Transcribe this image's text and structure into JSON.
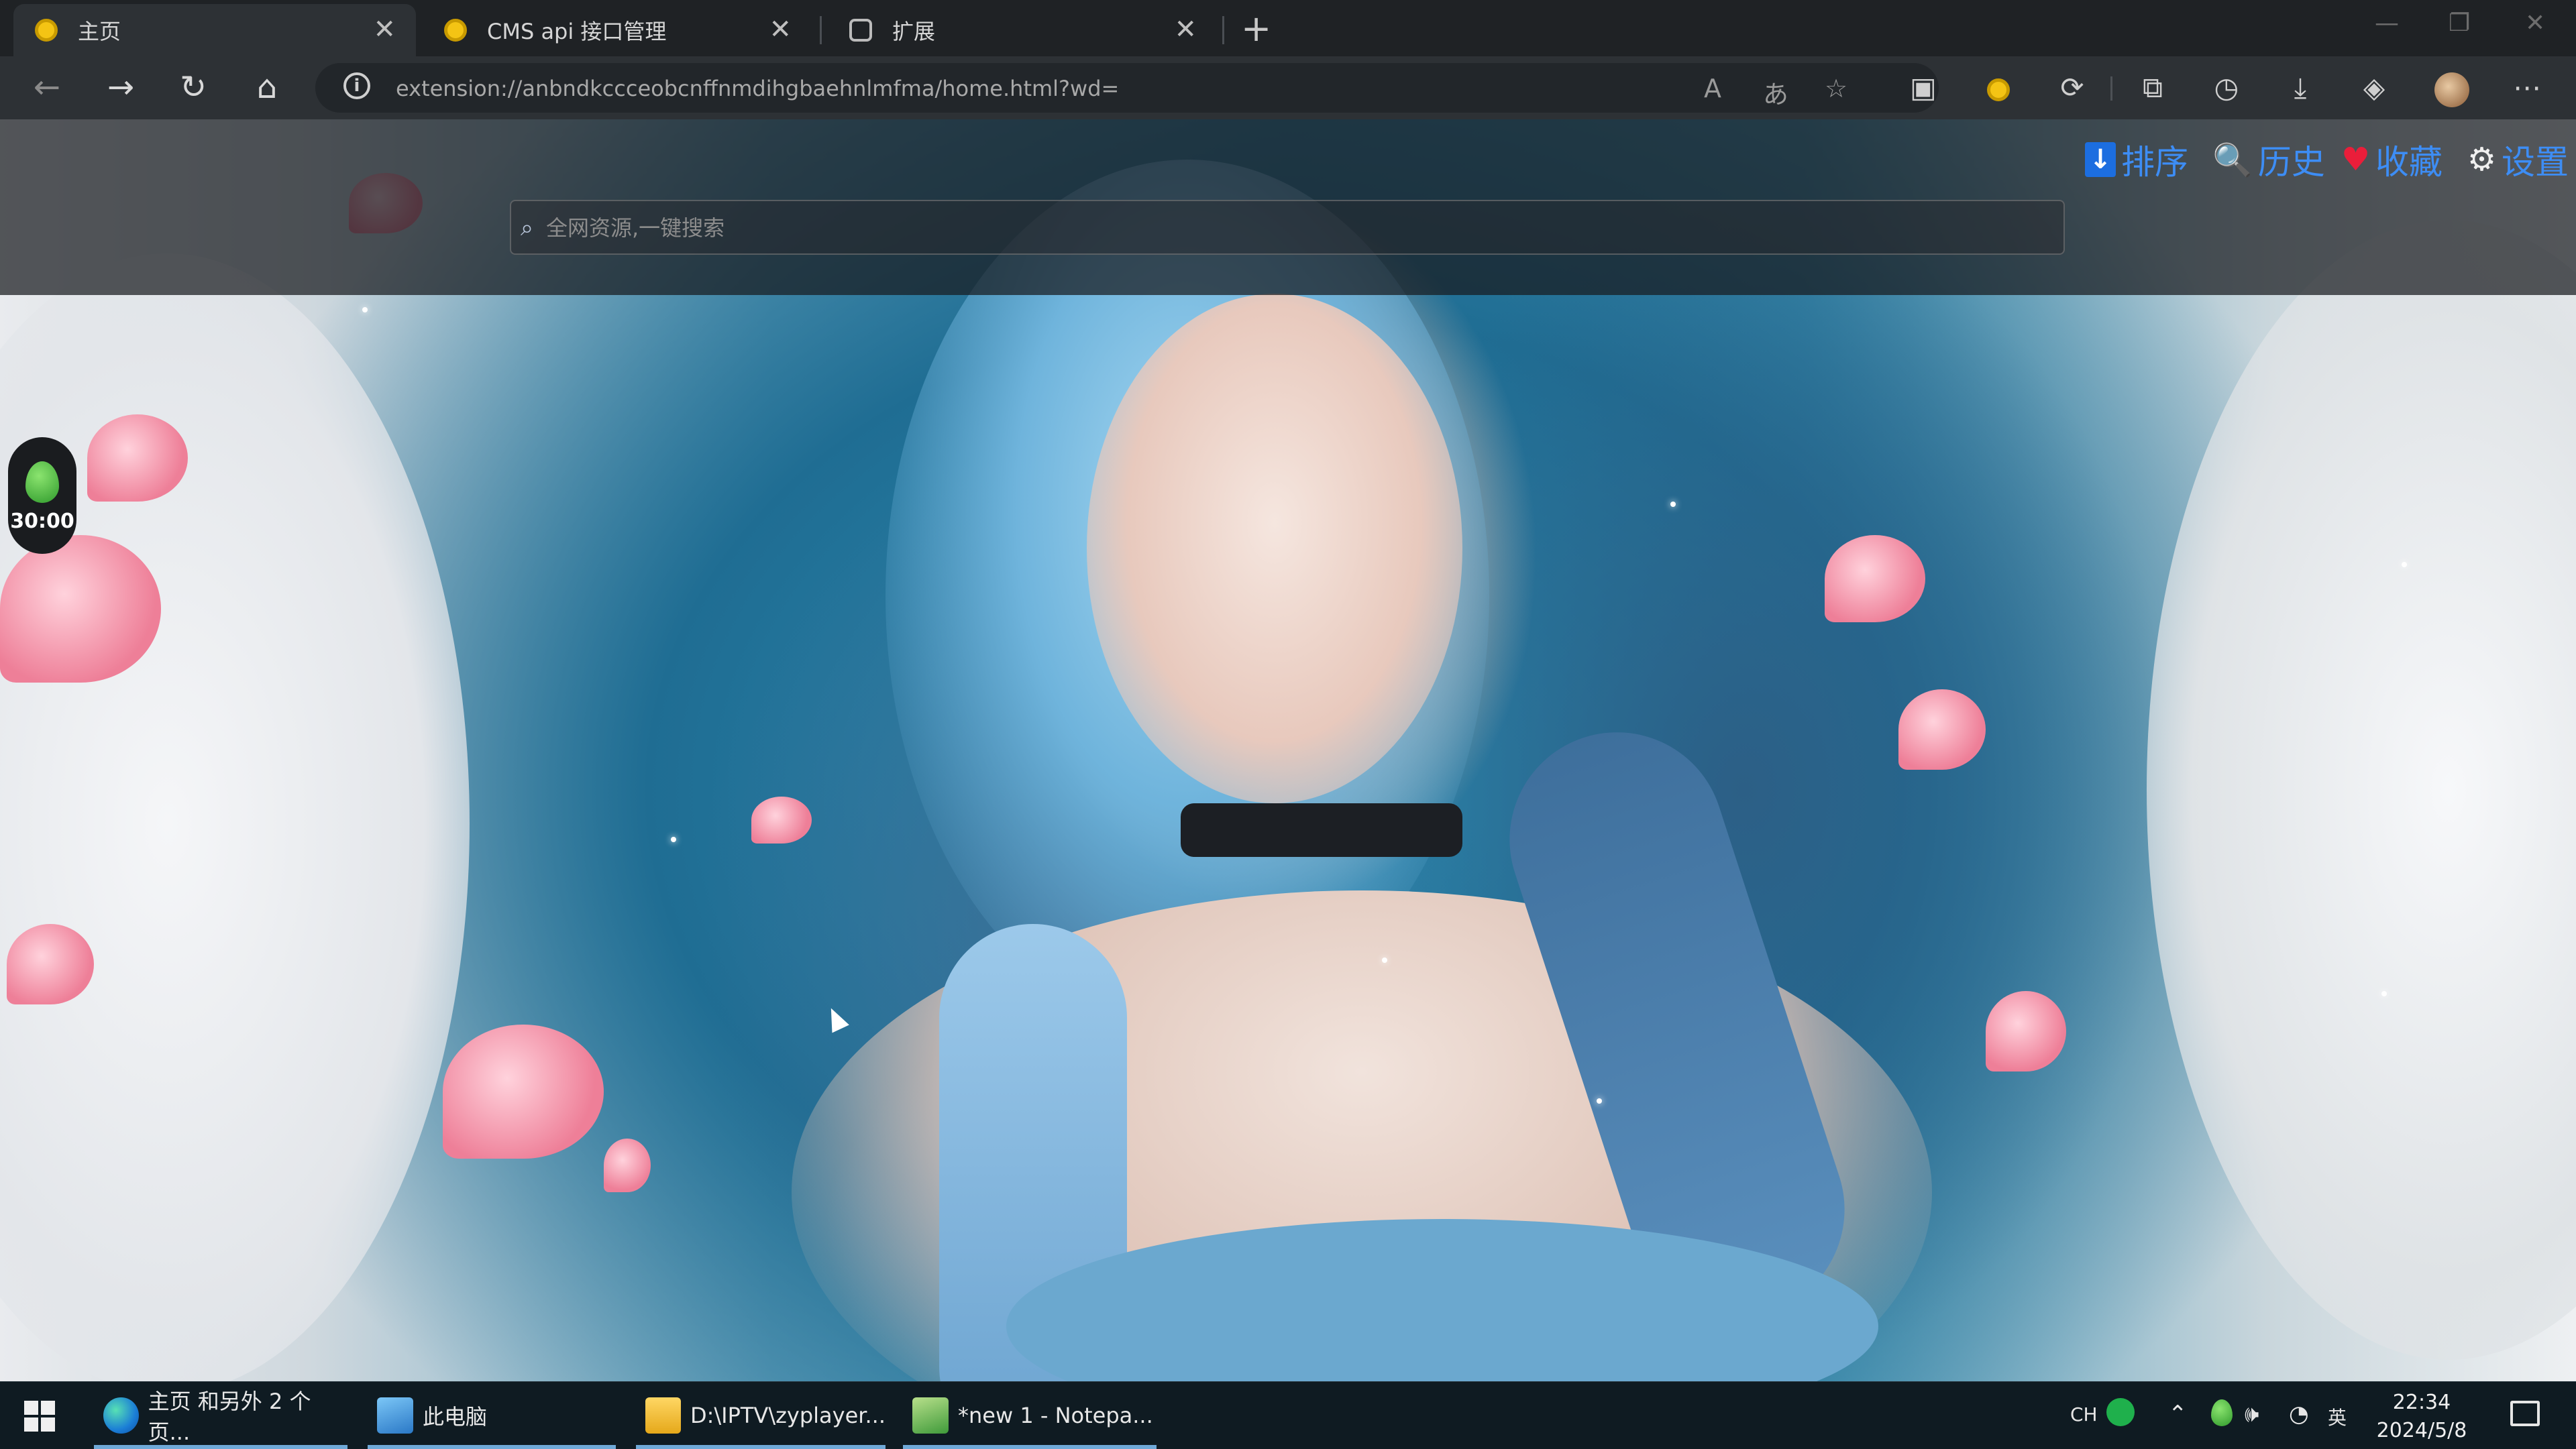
{
  "browser": {
    "tabs": [
      {
        "label": "主页",
        "close": "✕"
      },
      {
        "label": "CMS api 接口管理",
        "close": "✕"
      },
      {
        "label": "扩展",
        "close": "✕"
      }
    ],
    "new_tab": "+",
    "url": "extension://anbndkccceobcnffnmdihgbaehnlmfma/home.html?wd=",
    "window_controls": {
      "minimize": "—",
      "restore": "❐",
      "close": "✕"
    }
  },
  "page": {
    "search": {
      "placeholder": "全网资源,一键搜索"
    },
    "nav": [
      {
        "icon": "sort-icon",
        "label": "排序"
      },
      {
        "icon": "search-icon",
        "label": "历史"
      },
      {
        "icon": "heart-icon",
        "label": "收藏"
      },
      {
        "icon": "gear-icon",
        "label": "设置"
      }
    ],
    "timer": {
      "value": "30:00"
    }
  },
  "taskbar": {
    "items": [
      {
        "label": "主页 和另外 2 个页...",
        "icon": "edge-icon"
      },
      {
        "label": "此电脑",
        "icon": "computer-icon"
      },
      {
        "label": "D:\\IPTV\\zyplayer...",
        "icon": "folder-icon"
      },
      {
        "label": "*new 1 - Notepa...",
        "icon": "notepad-icon"
      }
    ],
    "tray": {
      "ime": "CH",
      "ime2": "英",
      "time": "22:34",
      "date": "2024/5/8"
    }
  },
  "colors": {
    "accent": "#3d8df5",
    "heart": "#ea1e3a",
    "tab_bg": "#2d3135"
  }
}
